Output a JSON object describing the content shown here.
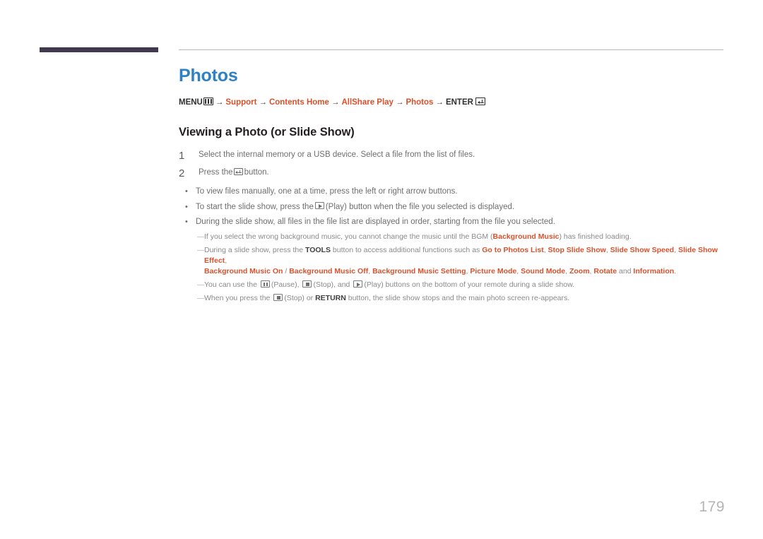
{
  "page": {
    "number": "179",
    "chapter_title": "Photos",
    "title_color": "#2e81c4",
    "accent_color": "#d9512c",
    "header_bar_color": "#413a4e"
  },
  "breadcrumb": {
    "menu_label": "MENU",
    "menu_icon": "menu-bars-icon",
    "arrow": "→",
    "items": [
      {
        "label": "Support",
        "style": "link"
      },
      {
        "label": "Contents Home",
        "style": "link"
      },
      {
        "label": "AllShare Play",
        "style": "link"
      },
      {
        "label": "Photos",
        "style": "link"
      }
    ],
    "enter_label": "ENTER",
    "enter_icon": "enter-return-icon"
  },
  "section": {
    "title": "Viewing a Photo (or Slide Show)"
  },
  "steps": [
    {
      "number": "1",
      "text": "Select the internal memory or a USB device. Select a file from the list of files."
    },
    {
      "number": "2",
      "text_before": "Press the",
      "icon": "enter-return-icon",
      "text_after": "button."
    }
  ],
  "bullets": [
    {
      "marker": "•",
      "text": "To view files manually, one at a time, press the left or right arrow buttons."
    },
    {
      "marker": "•",
      "text_before": "To start the slide show, press the",
      "icon": "play-button-icon",
      "text_after": "(Play) button when the file you selected is displayed."
    },
    {
      "marker": "•",
      "text": "During the slide show, all files in the file list are displayed in order, starting from the file you selected."
    }
  ],
  "notes": [
    {
      "dash": "—",
      "part1": "If you select the wrong background music, you cannot change the music until the BGM (",
      "bold_orange": "Background Music",
      "part2": ") has finished loading."
    },
    {
      "dash": "—",
      "part1": "During a slide show, press the ",
      "bold_dark": "TOOLS",
      "part2": " button to access additional functions such as ",
      "functions_line1": [
        "Go to Photos List",
        "Stop Slide Show",
        "Slide Show Speed",
        "Slide Show Effect"
      ],
      "functions_line2_a": "Background Music On",
      "functions_line2_sep": " / ",
      "functions_line2_b": "Background Music Off",
      "functions_line2_rest": [
        "Background Music Setting",
        "Picture Mode",
        "Sound Mode",
        "Zoom",
        "Rotate"
      ],
      "and_word": " and ",
      "functions_last": "Information",
      "period": "."
    },
    {
      "dash": "—",
      "part1": "You can use the ",
      "icon1": "pause-button-icon",
      "part2": "(Pause), ",
      "icon2": "stop-button-icon",
      "part3": "(Stop), and ",
      "icon3": "play-button-icon",
      "part4": "(Play) buttons on the bottom of your remote during a slide show."
    },
    {
      "dash": "—",
      "part1": "When you press the ",
      "icon1": "stop-button-icon",
      "part2": "(Stop) or ",
      "bold_dark": "RETURN",
      "part3": " button, the slide show stops and the main photo screen re-appears."
    }
  ]
}
